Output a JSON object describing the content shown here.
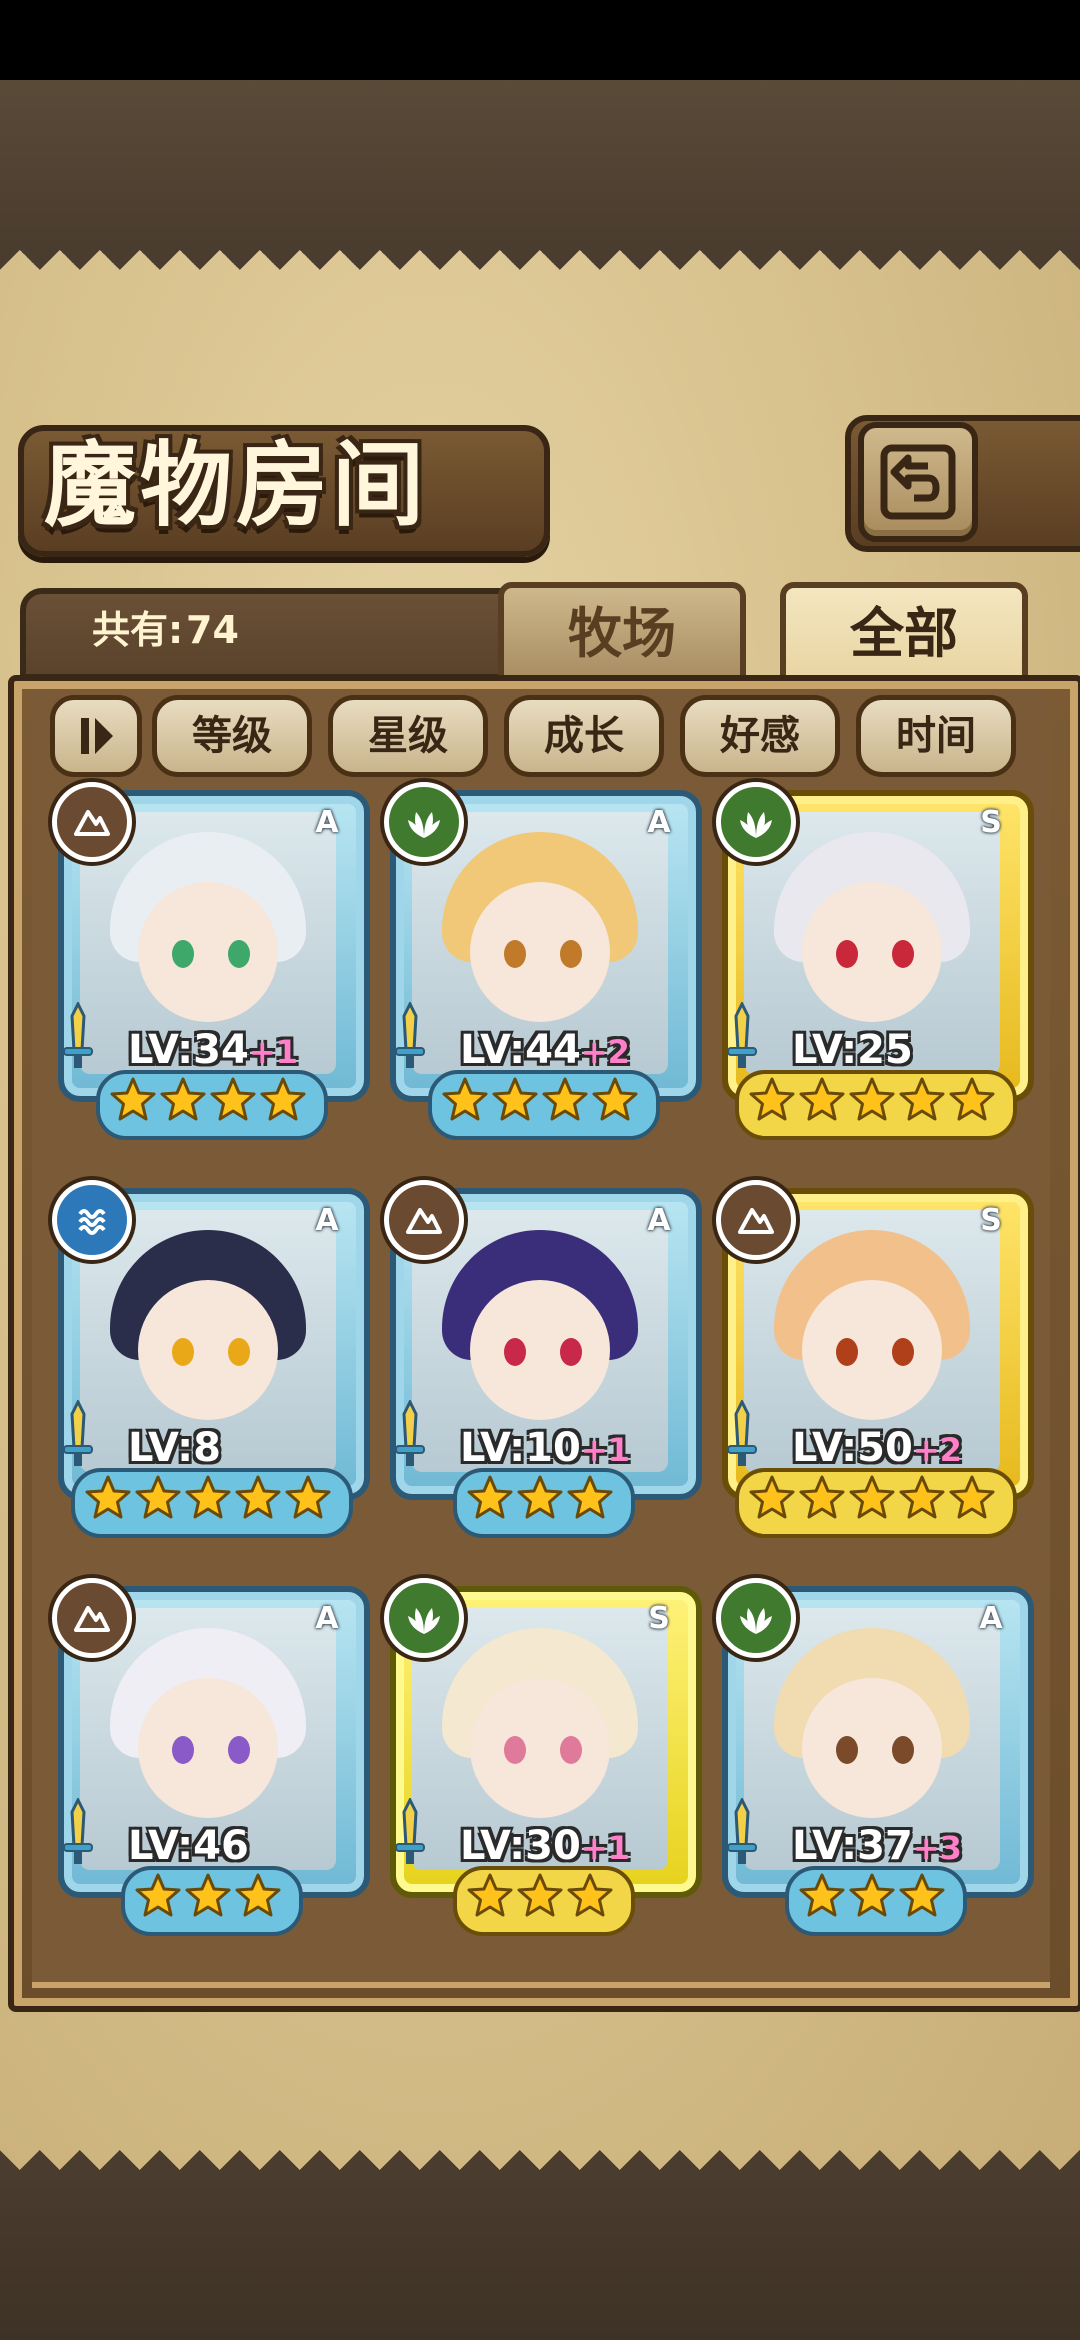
{
  "header": {
    "title": "魔物房间"
  },
  "info": {
    "count_label": "共有:",
    "count_value": "74"
  },
  "tabs": [
    {
      "label": "牧场",
      "selected": false
    },
    {
      "label": "全部",
      "selected": true
    }
  ],
  "sort_buttons": [
    {
      "label": "等级"
    },
    {
      "label": "星级"
    },
    {
      "label": "成长"
    },
    {
      "label": "好感"
    },
    {
      "label": "时间"
    }
  ],
  "filter_toggle_icon": "filter-toggle-icon",
  "back_icon": "return-arrow-icon",
  "colors": {
    "earth_element": "#6b4a32",
    "nature_element": "#3f7a2e",
    "water_element": "#2d78b8",
    "star": "#ffc21a",
    "level_plus": "#ff7fc8"
  },
  "monsters": [
    {
      "rank": "A",
      "element": "earth",
      "level": "LV:34",
      "plus": "+1",
      "stars": 4
    },
    {
      "rank": "A",
      "element": "nature",
      "level": "LV:44",
      "plus": "+2",
      "stars": 4
    },
    {
      "rank": "S",
      "element": "nature",
      "level": "LV:25",
      "plus": "",
      "stars": 5
    },
    {
      "rank": "A",
      "element": "water",
      "level": "LV:8",
      "plus": "",
      "stars": 5
    },
    {
      "rank": "A",
      "element": "earth",
      "level": "LV:10",
      "plus": "+1",
      "stars": 3
    },
    {
      "rank": "S",
      "element": "earth",
      "level": "LV:50",
      "plus": "+2",
      "stars": 5
    },
    {
      "rank": "A",
      "element": "earth",
      "level": "LV:46",
      "plus": "",
      "stars": 3
    },
    {
      "rank": "S",
      "element": "nature",
      "level": "LV:30",
      "plus": "+1",
      "stars": 3
    },
    {
      "rank": "A",
      "element": "nature",
      "level": "LV:37",
      "plus": "+3",
      "stars": 3
    }
  ]
}
